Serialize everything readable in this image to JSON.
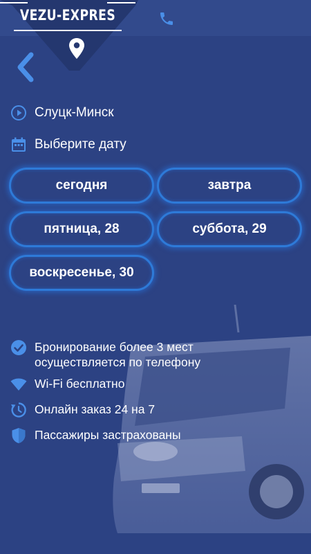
{
  "header": {
    "logo_text": "VEZU-EXPRES",
    "logo_icon": "map-pin-icon",
    "phone_icon": "phone-icon",
    "back_icon": "chevron-left-icon"
  },
  "route": {
    "icon": "play-circle-icon",
    "label": "Слуцк-Минск"
  },
  "date_prompt": {
    "icon": "calendar-icon",
    "label": "Выберите дату"
  },
  "dates": [
    {
      "label": "сегодня"
    },
    {
      "label": "завтра"
    },
    {
      "label": "пятница, 28"
    },
    {
      "label": "суббота, 29"
    },
    {
      "label": "воскресенье, 30"
    }
  ],
  "features": [
    {
      "icon": "check-circle-icon",
      "line1": "Бронирование более 3 мест",
      "line2": "осуществляется по телефону"
    },
    {
      "icon": "wifi-icon",
      "line1": "Wi-Fi бесплатно"
    },
    {
      "icon": "clock-refresh-icon",
      "line1": "Онлайн заказ 24 на 7"
    },
    {
      "icon": "shield-icon",
      "line1": "Пассажиры застрахованы"
    }
  ],
  "colors": {
    "background": "#2c4283",
    "accent": "#4a8fe8",
    "pill_border": "#2e7ad8",
    "text": "#ffffff"
  }
}
